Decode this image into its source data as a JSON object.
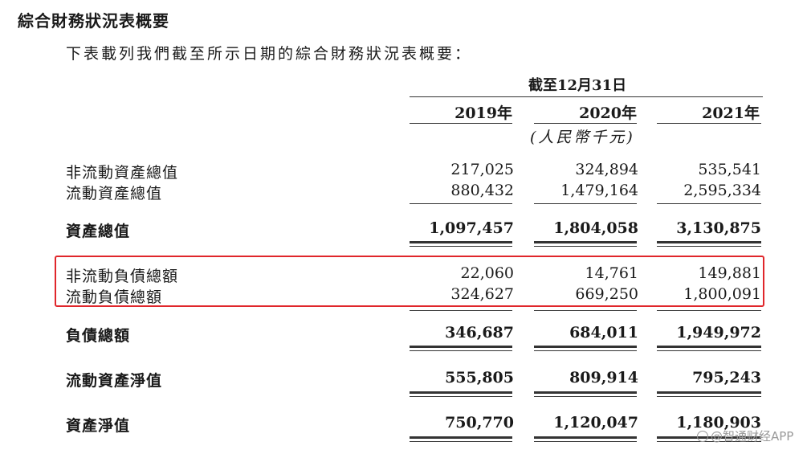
{
  "title": "綜合財務狀況表概要",
  "intro": "下表載列我們截至所示日期的綜合財務狀況表概要：",
  "period_header": "截至12月31日",
  "years": [
    "2019年",
    "2020年",
    "2021年"
  ],
  "unit": "(人民幣千元)",
  "rows": [
    {
      "label": "非流動資產總值",
      "values": [
        "217,025",
        "324,894",
        "535,541"
      ]
    },
    {
      "label": "流動資產總值",
      "values": [
        "880,432",
        "1,479,164",
        "2,595,334"
      ]
    },
    {
      "label": "資產總值",
      "values": [
        "1,097,457",
        "1,804,058",
        "3,130,875"
      ]
    },
    {
      "label": "非流動負債總額",
      "values": [
        "22,060",
        "14,761",
        "149,881"
      ]
    },
    {
      "label": "流動負債總額",
      "values": [
        "324,627",
        "669,250",
        "1,800,091"
      ]
    },
    {
      "label": "負債總額",
      "values": [
        "346,687",
        "684,011",
        "1,949,972"
      ]
    },
    {
      "label": "流動資產淨值",
      "values": [
        "555,805",
        "809,914",
        "795,243"
      ]
    },
    {
      "label": "資產淨值",
      "values": [
        "750,770",
        "1,120,047",
        "1,180,903"
      ]
    }
  ],
  "watermark": "@智通财经APP",
  "colors": {
    "highlight_border": "#e0262b",
    "text": "#1a1a1a",
    "watermark": "#9a9a9a"
  }
}
